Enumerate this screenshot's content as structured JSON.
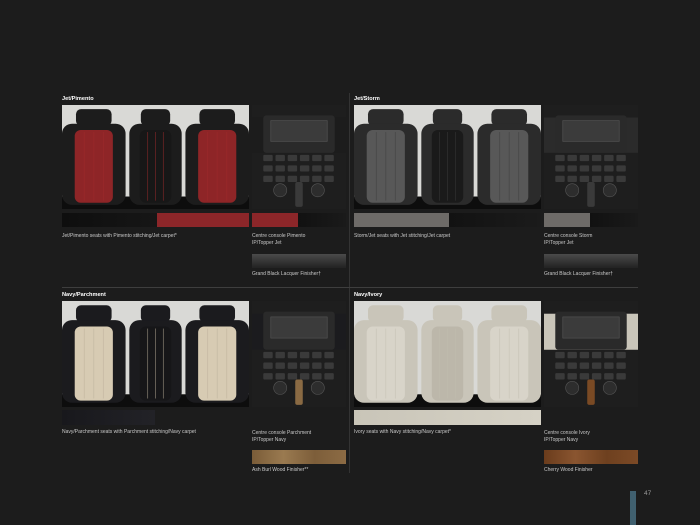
{
  "page_number": "47",
  "sections": [
    {
      "title": "Jet/Pimento",
      "seat_caption": "Jet/Pimento seats with Pimento stitching/Jet carpet*",
      "console_caption_1": "Centre console Pimento",
      "console_caption_2": "IP/Topper Jet",
      "veneer_caption": "Grand Black Lacquer Finisher†",
      "colors": {
        "outer": "#1c1c1c",
        "center": "#171717",
        "side": "#8e2527",
        "accent": "#a12b2d",
        "swatch": "#8c2629",
        "veneer": "#3a3a3a"
      }
    },
    {
      "title": "Jet/Storm",
      "seat_caption": "Storm/Jet seats with Jet stitching/Jet carpet",
      "console_caption_1": "Centre console Storm",
      "console_caption_2": "IP/Topper Jet",
      "veneer_caption": "Grand Black Lacquer Finisher†",
      "colors": {
        "outer": "#2b2b2b",
        "center": "#1a1a1a",
        "side": "#585858",
        "accent": "#3c3c3c",
        "swatch": "#6e6b68",
        "veneer": "#3a3a3a"
      }
    },
    {
      "title": "Navy/Parchment",
      "seat_caption": "Navy/Parchment seats with Parchment stitching/Navy carpet",
      "console_caption_1": "Centre console Parchment",
      "console_caption_2": "IP/Topper Navy",
      "veneer_caption": "Ash Burl Wood Finisher**",
      "colors": {
        "outer": "#1b1b1e",
        "center": "#161618",
        "side": "#d7cbb3",
        "accent": "#bcb09a",
        "swatch": "#2a2a2e",
        "veneer": "#8a6a43"
      }
    },
    {
      "title": "Navy/Ivory",
      "seat_caption": "Ivory seats with Navy stitching/Navy carpet*",
      "console_caption_1": "Centre console Ivory",
      "console_caption_2": "IP/Topper Navy",
      "veneer_caption": "Cherry Wood Finisher",
      "colors": {
        "outer": "#c9c5b9",
        "center": "#bcb7aa",
        "side": "#d8d4c9",
        "accent": "#c2bdb0",
        "swatch": "#c8c4b8",
        "veneer": "#7a4a24"
      }
    }
  ]
}
